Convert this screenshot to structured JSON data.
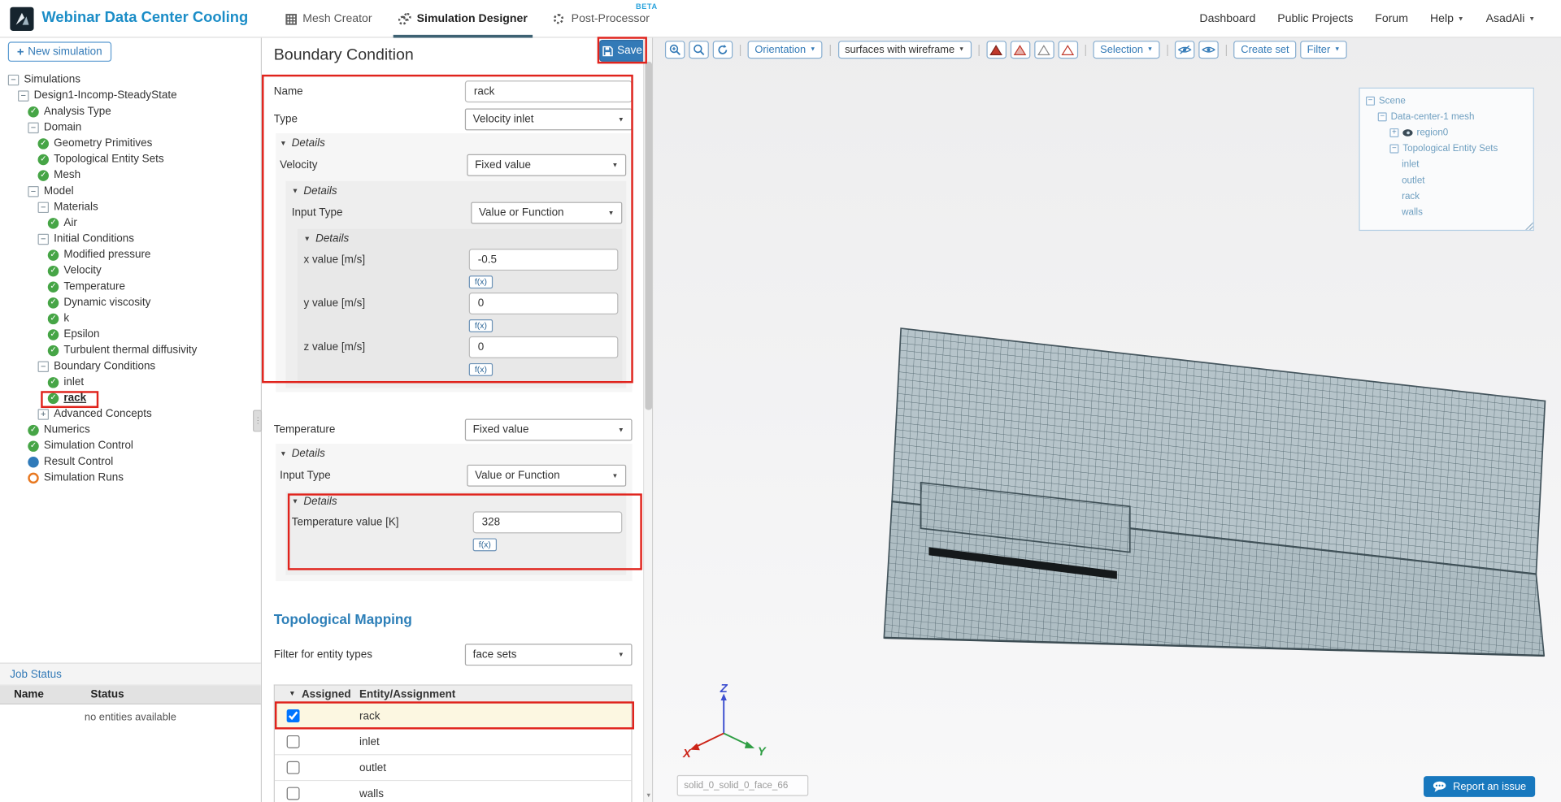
{
  "topbar": {
    "title": "Webinar Data Center Cooling",
    "tabs": [
      {
        "label": "Mesh Creator",
        "icon": "grid-icon"
      },
      {
        "label": "Simulation Designer",
        "icon": "gears-icon",
        "active": true
      },
      {
        "label": "Post-Processor",
        "icon": "gear-icon",
        "badge": "BETA"
      }
    ],
    "links": [
      {
        "label": "Dashboard"
      },
      {
        "label": "Public Projects"
      },
      {
        "label": "Forum"
      },
      {
        "label": "Help",
        "caret": true
      },
      {
        "label": "AsadAli",
        "caret": true
      }
    ]
  },
  "sidebar": {
    "new_simulation": "New simulation",
    "tree": [
      {
        "label": "Simulations",
        "depth": 0,
        "icon": "minus-box"
      },
      {
        "label": "Design1-Incomp-SteadyState",
        "depth": 1,
        "icon": "minus-box"
      },
      {
        "label": "Analysis Type",
        "depth": 2,
        "icon": "check"
      },
      {
        "label": "Domain",
        "depth": 2,
        "icon": "minus-box"
      },
      {
        "label": "Geometry Primitives",
        "depth": 3,
        "icon": "check"
      },
      {
        "label": "Topological Entity Sets",
        "depth": 3,
        "icon": "check"
      },
      {
        "label": "Mesh",
        "depth": 3,
        "icon": "check"
      },
      {
        "label": "Model",
        "depth": 2,
        "icon": "minus-box"
      },
      {
        "label": "Materials",
        "depth": 3,
        "icon": "minus-box"
      },
      {
        "label": "Air",
        "depth": 4,
        "icon": "check"
      },
      {
        "label": "Initial Conditions",
        "depth": 3,
        "icon": "minus-box"
      },
      {
        "label": "Modified pressure",
        "depth": 4,
        "icon": "check"
      },
      {
        "label": "Velocity",
        "depth": 4,
        "icon": "check"
      },
      {
        "label": "Temperature",
        "depth": 4,
        "icon": "check"
      },
      {
        "label": "Dynamic viscosity",
        "depth": 4,
        "icon": "check"
      },
      {
        "label": "k",
        "depth": 4,
        "icon": "check"
      },
      {
        "label": "Epsilon",
        "depth": 4,
        "icon": "check"
      },
      {
        "label": "Turbulent thermal diffusivity",
        "depth": 4,
        "icon": "check"
      },
      {
        "label": "Boundary Conditions",
        "depth": 3,
        "icon": "minus-box"
      },
      {
        "label": "inlet",
        "depth": 4,
        "icon": "check"
      },
      {
        "label": "rack",
        "depth": 4,
        "icon": "check",
        "selected": true
      },
      {
        "label": "Advanced Concepts",
        "depth": 3,
        "icon": "plus-box"
      },
      {
        "label": "Numerics",
        "depth": 2,
        "icon": "check"
      },
      {
        "label": "Simulation Control",
        "depth": 2,
        "icon": "check"
      },
      {
        "label": "Result Control",
        "depth": 2,
        "icon": "blue-dot"
      },
      {
        "label": "Simulation Runs",
        "depth": 2,
        "icon": "orange-circle"
      }
    ],
    "job_status": {
      "title": "Job Status",
      "name_col": "Name",
      "status_col": "Status",
      "empty": "no entities available"
    }
  },
  "panel": {
    "title": "Boundary Condition",
    "save": "Save",
    "details_label": "Details",
    "fx": "f(x)",
    "name_label": "Name",
    "name_value": "rack",
    "type_label": "Type",
    "type_value": "Velocity inlet",
    "velocity_label": "Velocity",
    "velocity_value": "Fixed value",
    "input_type_label": "Input Type",
    "input_type_value": "Value or Function",
    "x_label": "x value [m/s]",
    "x_value": "-0.5",
    "y_label": "y value [m/s]",
    "y_value": "0",
    "z_label": "z value [m/s]",
    "z_value": "0",
    "temperature_label": "Temperature",
    "temperature_value": "Fixed value",
    "temp_input_type_label": "Input Type",
    "temp_input_type_value": "Value or Function",
    "temp_value_label": "Temperature value [K]",
    "temp_value": "328",
    "topological_mapping_title": "Topological Mapping",
    "filter_label": "Filter for entity types",
    "filter_value": "face sets",
    "assigned_col": "Assigned",
    "entity_col": "Entity/Assignment",
    "assignments": [
      {
        "label": "rack",
        "checked": true
      },
      {
        "label": "inlet"
      },
      {
        "label": "outlet"
      },
      {
        "label": "walls"
      }
    ]
  },
  "viewport": {
    "toolbar": {
      "orientation": "Orientation",
      "render_mode": "surfaces with wireframe",
      "selection": "Selection",
      "create_set": "Create set",
      "filter": "Filter"
    },
    "scene_tree": [
      {
        "label": "Scene",
        "depth": 0,
        "icon": "s-minus"
      },
      {
        "label": "Data-center-1 mesh",
        "depth": 1,
        "icon": "s-minus"
      },
      {
        "label": "region0",
        "depth": 2,
        "icon": "s-plus",
        "eye": true
      },
      {
        "label": "Topological Entity Sets",
        "depth": 2,
        "icon": "s-minus"
      },
      {
        "label": "inlet",
        "depth": 3
      },
      {
        "label": "outlet",
        "depth": 3
      },
      {
        "label": "rack",
        "depth": 3
      },
      {
        "label": "walls",
        "depth": 3
      }
    ],
    "face_label": "solid_0_solid_0_face_66",
    "report_issue": "Report an issue",
    "axes": {
      "x": "X",
      "y": "Y",
      "z": "Z"
    }
  },
  "colors": {
    "brand_blue": "#1b8dc7",
    "accent_blue": "#337ab7",
    "success_green": "#46a546",
    "annotation_red": "#e0231c",
    "selected_row_bg": "#fcf7e1",
    "mesh_top_fill": "#b6c4ca",
    "mesh_front_fill": "#aebdc3"
  }
}
